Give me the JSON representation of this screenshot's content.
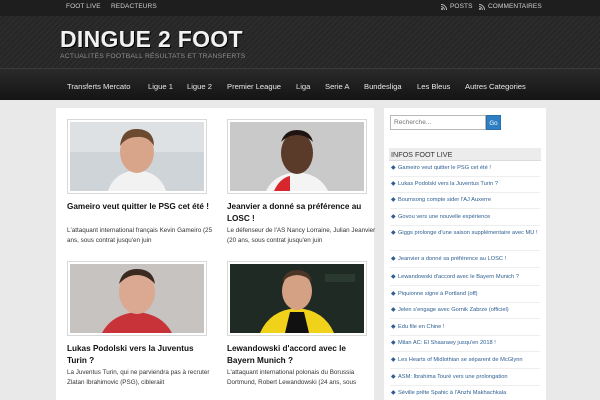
{
  "topbar": {
    "left": [
      "FOOT LIVE",
      "REDACTEURS"
    ],
    "right": [
      "POSTS",
      "COMMENTAIRES"
    ],
    "icon": "rss-icon"
  },
  "header": {
    "logo": "DINGUE 2 FOOT",
    "tagline": "ACTUALITÉS FOOTBALL RÉSULTATS ET TRANSFERTS"
  },
  "nav": [
    "Transferts Mercato",
    "Ligue 1",
    "Ligue 2",
    "Premier League",
    "Liga",
    "Serie A",
    "Bundesliga",
    "Les Bleus",
    "Autres Categories"
  ],
  "posts": [
    {
      "title": "Gameiro veut quitter le PSG cet été !",
      "excerpt": "L'attaquant international français Kevin Gameiro (25 ans, sous contrat jusqu'en juin"
    },
    {
      "title": "Jeanvier a donné sa préférence au LOSC !",
      "excerpt": "Le défenseur de l'AS Nancy Lorraine, Julian Jeanvier (20 ans, sous contrat jusqu'en juin"
    },
    {
      "title": "Lukas Podolski vers la Juventus Turin ?",
      "excerpt": "La Juventus Turin, qui ne parviendra pas à recruter Zlatan Ibrahimovic (PSG), cibleraiit"
    },
    {
      "title": "Lewandowski d'accord avec le Bayern Munich ?",
      "excerpt": "L'attaquant international polonais du Borussia Dortmund, Robert Lewandowski (24 ans, sous"
    }
  ],
  "sidebar": {
    "search_placeholder": "Recherche...",
    "search_button": "Go",
    "widget_title": "INFOS FOOT LIVE",
    "items": [
      "Gameiro veut quitter le PSG cet été !",
      "Lukas Podolski vers la Juventus Turin ?",
      "Boumsong compte sider l'AJ Auxerre",
      "Govou vers une nouvelle expérience",
      "Giggs prolonge d'une saison supplémentaire avec MU !",
      "Jeanvier a donné sa préférence au LOSC !",
      "Lewandowski d'accord avec le Bayern Munich ?",
      "Piquionne signe à Portland (off)",
      "Jelen s'engage avec Gornik Zabrze (officiel)",
      "Edu file en Chine !",
      "Milan AC: El Shaarawy jusqu'en 2018 !",
      "Les Hearts of Midlothian se séparent de McGlynn",
      "ASM: Ibrahima Touré vers une prolongation",
      "Séville prête Spahic à l'Anzhi Makhachkala"
    ]
  }
}
